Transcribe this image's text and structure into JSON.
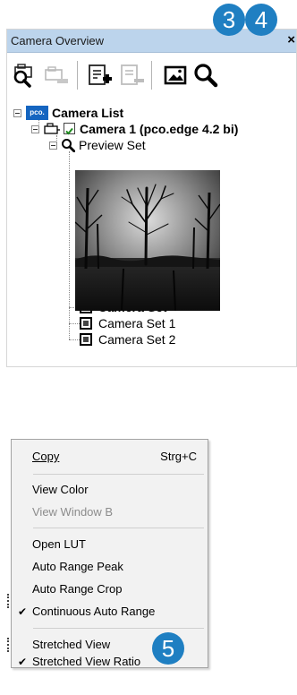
{
  "panel": {
    "title": "Camera Overview",
    "close_glyph": "×"
  },
  "toolbar": {
    "buttons": [
      {
        "icon": "camera-search-icon",
        "enabled": true
      },
      {
        "icon": "camera-remove-icon",
        "enabled": false
      },
      {
        "icon": "set-add-icon",
        "enabled": true
      },
      {
        "icon": "set-remove-icon",
        "enabled": false
      },
      {
        "icon": "image-icon",
        "enabled": true
      },
      {
        "icon": "magnifier-icon",
        "enabled": true
      }
    ]
  },
  "tree": {
    "root_logo": "pco.",
    "root_label": "Camera List",
    "camera_label": "Camera 1 (pco.edge 4.2 bi)",
    "camera_checked": true,
    "preview_label": "Preview Set",
    "sets": [
      "Camera Set",
      "Camera Set 1",
      "Camera Set 2"
    ]
  },
  "callouts": [
    "3",
    "4",
    "5"
  ],
  "context_menu": {
    "items": [
      {
        "label": "Copy",
        "shortcut": "Strg+C",
        "checked": false,
        "enabled": true
      },
      {
        "label": "View Color",
        "checked": false,
        "enabled": true
      },
      {
        "label": "View Window B",
        "checked": false,
        "enabled": false
      },
      {
        "label": "Open LUT",
        "checked": false,
        "enabled": true
      },
      {
        "label": "Auto Range Peak",
        "checked": false,
        "enabled": true
      },
      {
        "label": "Auto Range Crop",
        "checked": false,
        "enabled": true
      },
      {
        "label": "Continuous Auto Range",
        "checked": true,
        "enabled": true
      },
      {
        "label": "Stretched View",
        "checked": false,
        "enabled": true
      },
      {
        "label": "Stretched View Ratio",
        "checked": true,
        "enabled": true
      }
    ]
  },
  "colors": {
    "titlebar": "#bcd4ec",
    "callout": "#1f7fc2",
    "check_green": "#1e8c1e",
    "pco_blue": "#1565c0"
  }
}
